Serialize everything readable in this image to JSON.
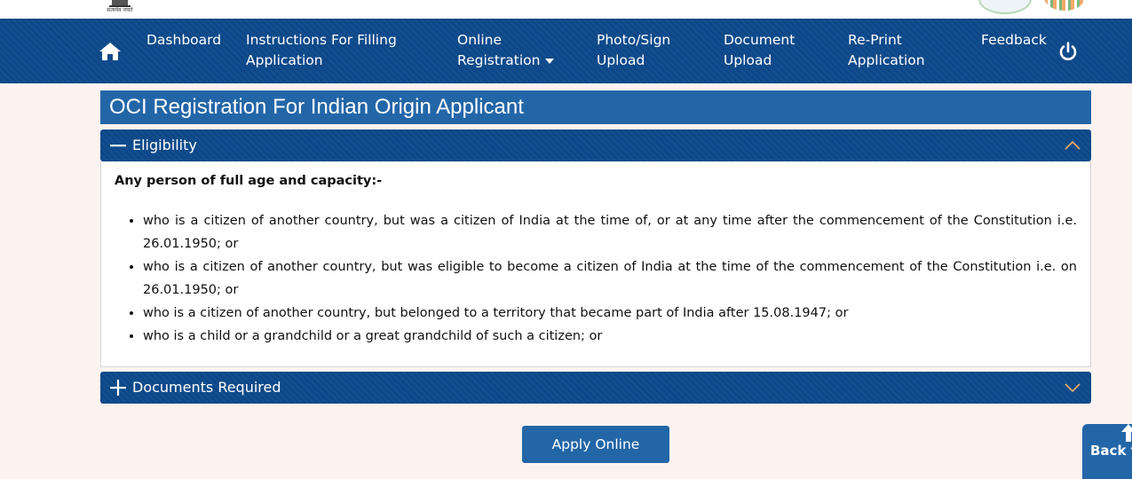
{
  "header": {
    "emblem_motto": "सत्यमेव जयते",
    "emblem_icon": "national-emblem-icon",
    "right_logo_icons": [
      "partner-logo-icon",
      "campaign-logo-icon"
    ]
  },
  "nav": {
    "home_icon": "home-icon",
    "items": [
      {
        "line1": "Dashboard",
        "line2": ""
      },
      {
        "line1": "Instructions For Filling",
        "line2": "Application"
      },
      {
        "line1": "Online",
        "line2": "Registration"
      },
      {
        "line1": "Photo/Sign",
        "line2": "Upload"
      },
      {
        "line1": "Document",
        "line2": "Upload"
      },
      {
        "line1": "Re-Print",
        "line2": "Application"
      },
      {
        "line1": "Feedback",
        "line2": ""
      }
    ],
    "power_icon": "power-icon"
  },
  "page": {
    "title": "OCI Registration For Indian Origin Applicant"
  },
  "eligibility": {
    "label": "Eligibility",
    "expanded": true,
    "lead": "Any person of full age and capacity:-",
    "items": [
      "who is a citizen of another country, but was a citizen of India at the time of, or at any time after the commencement of the Constitution i.e. 26.01.1950; or",
      "who is a citizen of another country, but was eligible to become a citizen of India at the time of the commencement of the Constitution i.e. on 26.01.1950; or",
      "who is a citizen of another country, but belonged to a territory that became part of India after 15.08.1947; or",
      "who is a child or a grandchild or a great grandchild of such a citizen; or"
    ]
  },
  "documents": {
    "label": "Documents Required",
    "expanded": false
  },
  "actions": {
    "apply_label": "Apply Online",
    "back_to_top_label": "Back to Top"
  },
  "colors": {
    "nav_bg": "#0c4889",
    "title_bg": "#2366a8",
    "chevron": "#f0b060",
    "page_bg": "#fcf3f0"
  }
}
